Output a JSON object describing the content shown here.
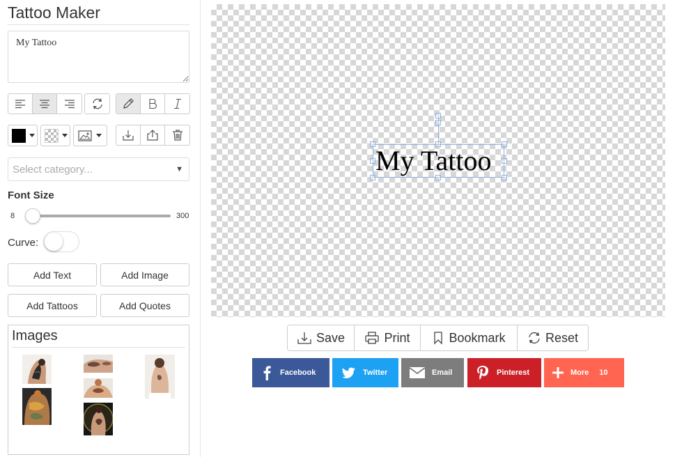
{
  "app": {
    "title": "Tattoo Maker"
  },
  "editor": {
    "text_value": "My Tattoo"
  },
  "toolbar": {
    "align_group": [
      "align-left",
      "align-center",
      "align-right"
    ],
    "active_align": "align-center",
    "style_group": [
      "pencil",
      "bold",
      "italic"
    ],
    "active_style": "pencil",
    "text_color": "#000000"
  },
  "category": {
    "placeholder": "Select category..."
  },
  "font_size": {
    "label": "Font Size",
    "min": "8",
    "max": "300",
    "value": 22
  },
  "curve": {
    "label": "Curve:",
    "enabled": false
  },
  "buttons": {
    "add_text": "Add Text",
    "add_image": "Add Image",
    "add_tattoos": "Add Tattoos",
    "add_quotes": "Add Quotes"
  },
  "images_panel": {
    "title": "Images"
  },
  "canvas": {
    "text": "My Tattoo"
  },
  "actions": {
    "save": "Save",
    "print": "Print",
    "bookmark": "Bookmark",
    "reset": "Reset"
  },
  "share": {
    "facebook": "Facebook",
    "twitter": "Twitter",
    "email": "Email",
    "pinterest": "Pinterest",
    "more": "More",
    "more_count": "10"
  },
  "colors": {
    "facebook": "#3b5998",
    "twitter": "#1da1f2",
    "email": "#7d7d7d",
    "pinterest": "#cb2027",
    "more": "#ff6550",
    "slider_fill": "#c9a75a",
    "selection": "#8fb2e0"
  }
}
